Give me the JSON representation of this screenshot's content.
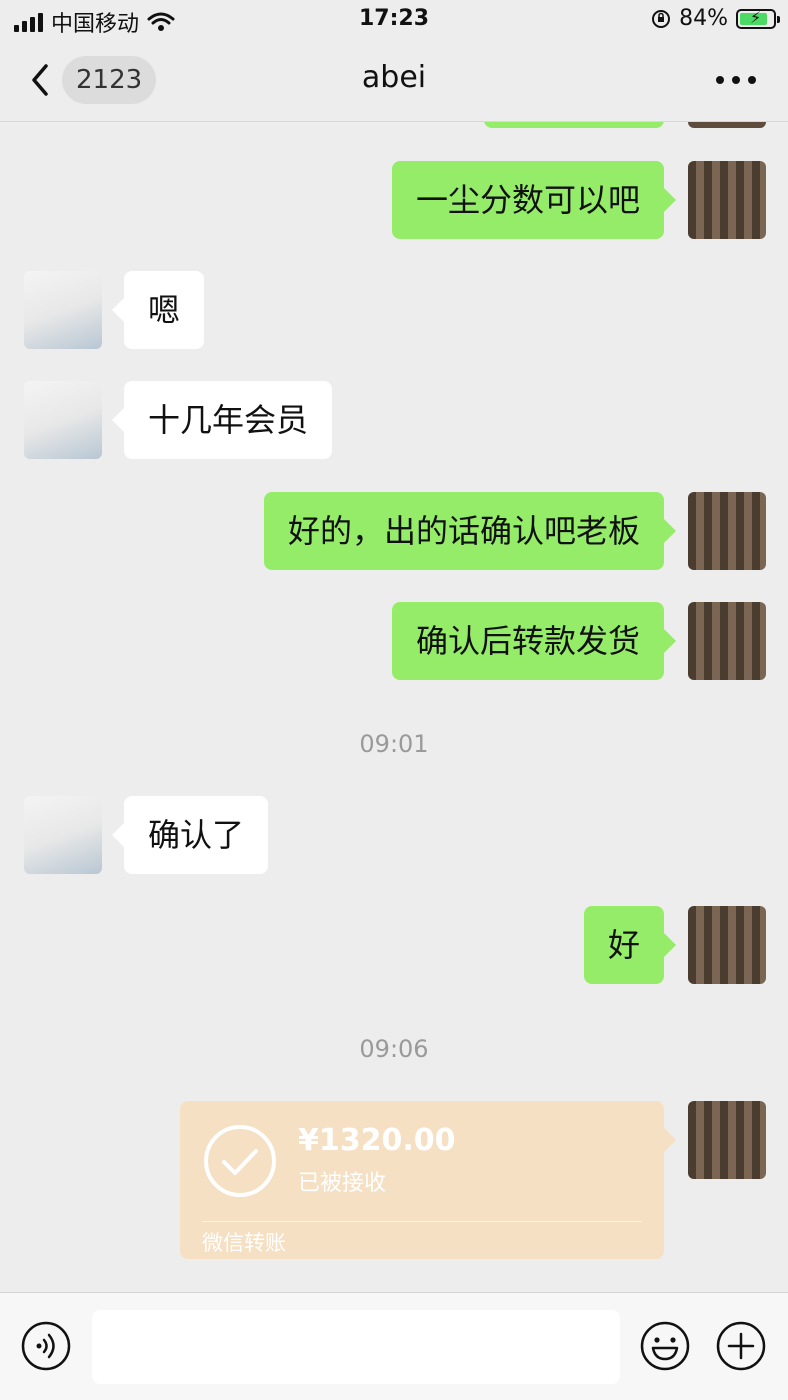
{
  "status_bar": {
    "carrier": "中国移动",
    "time": "17:23",
    "battery": "84%"
  },
  "header": {
    "back_icon": "chevron-left-icon",
    "unread_count": "2123",
    "title": "abei",
    "more_icon": "more-horizontal-icon"
  },
  "messages": [
    {
      "side": "out",
      "text": "一尘分数可以吧"
    },
    {
      "side": "in",
      "text": "嗯"
    },
    {
      "side": "in",
      "text": "十几年会员"
    },
    {
      "side": "out",
      "text": "好的，出的话确认吧老板"
    },
    {
      "side": "out",
      "text": "确认后转款发货"
    },
    {
      "type": "time",
      "text": "09:01"
    },
    {
      "side": "in",
      "text": "确认了"
    },
    {
      "side": "out",
      "text": "好"
    },
    {
      "type": "time",
      "text": "09:06"
    }
  ],
  "transfer": {
    "amount": "¥1320.00",
    "status": "已被接收",
    "label": "微信转账",
    "icon": "check-circle-icon"
  },
  "input_bar": {
    "voice_icon": "voice-icon",
    "emoji_icon": "emoji-icon",
    "plus_icon": "plus-circle-icon",
    "value": ""
  },
  "colors": {
    "background": "#ededed",
    "outgoing_bubble": "#95ec69",
    "incoming_bubble": "#ffffff",
    "transfer_card": "#f6e0c4"
  }
}
